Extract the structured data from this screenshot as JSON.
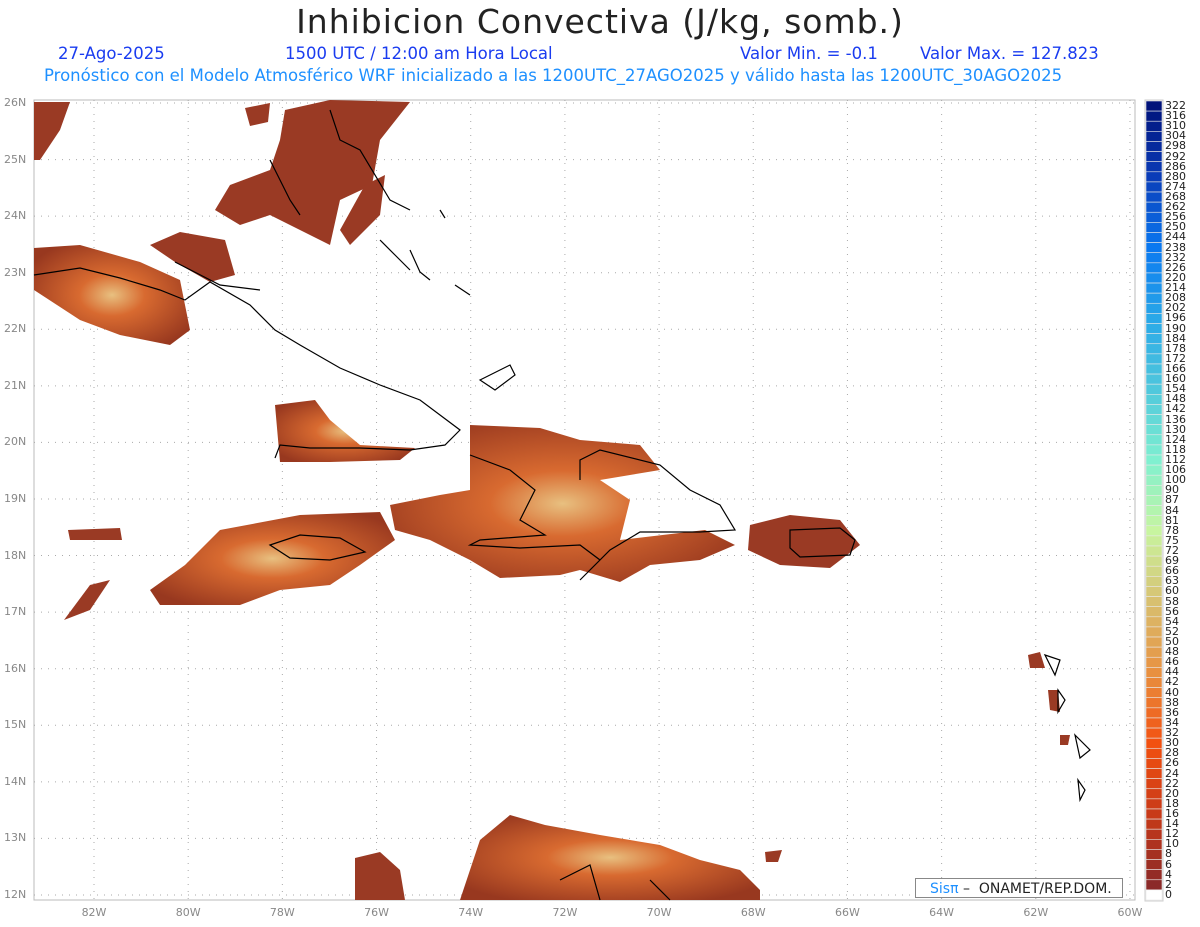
{
  "title": "Inhibicion Convectiva (J/kg, somb.)",
  "date": "27-Ago-2025",
  "time": "1500 UTC / 12:00 am Hora Local",
  "valmin": "Valor Min. = -0.1",
  "valmax": "Valor Max. = 127.823",
  "subtitle": "Pronóstico con el Modelo Atmosférico WRF inicializado a las 1200UTC_27AGO2025 y válido hasta las  1200UTC_30AGO2025",
  "lat_labels": [
    "26N",
    "25N",
    "24N",
    "23N",
    "22N",
    "21N",
    "20N",
    "19N",
    "18N",
    "17N",
    "16N",
    "15N",
    "14N",
    "13N",
    "12N"
  ],
  "lon_labels": [
    "82W",
    "80W",
    "78W",
    "76W",
    "74W",
    "72W",
    "70W",
    "68W",
    "66W",
    "64W",
    "62W",
    "60W"
  ],
  "colorbar_labels": [
    "322",
    "316",
    "310",
    "304",
    "298",
    "292",
    "286",
    "280",
    "274",
    "268",
    "262",
    "256",
    "250",
    "244",
    "238",
    "232",
    "226",
    "220",
    "214",
    "208",
    "202",
    "196",
    "190",
    "184",
    "178",
    "172",
    "166",
    "160",
    "154",
    "148",
    "142",
    "136",
    "130",
    "124",
    "118",
    "112",
    "106",
    "100",
    "90",
    "87",
    "84",
    "81",
    "78",
    "75",
    "72",
    "69",
    "66",
    "63",
    "60",
    "58",
    "56",
    "54",
    "52",
    "50",
    "48",
    "46",
    "44",
    "42",
    "40",
    "38",
    "36",
    "34",
    "32",
    "30",
    "28",
    "26",
    "24",
    "22",
    "20",
    "18",
    "16",
    "14",
    "12",
    "10",
    "8",
    "6",
    "4",
    "2",
    "0"
  ],
  "colorbar_palette": [
    "#00127a",
    "#0a3cb8",
    "#0a78f0",
    "#2aa8e8",
    "#50c8dc",
    "#80f0d0",
    "#c8f5a0",
    "#d8c070",
    "#e89040",
    "#f25010",
    "#c83a18",
    "#8b2a28"
  ],
  "credit": {
    "brand": "Sisπ",
    "text": " –  ONAMET/REP.DOM."
  }
}
